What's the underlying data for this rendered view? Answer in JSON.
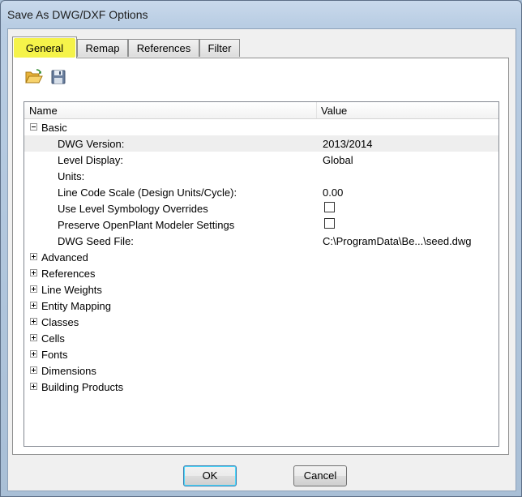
{
  "window": {
    "title": "Save As DWG/DXF Options"
  },
  "tabs": [
    {
      "label": "General",
      "active": true,
      "highlight": "#f5f34a"
    },
    {
      "label": "Remap"
    },
    {
      "label": "References"
    },
    {
      "label": "Filter"
    }
  ],
  "toolbar": {
    "open_icon": "folder-open-icon",
    "save_icon": "floppy-disk-icon"
  },
  "grid": {
    "headers": {
      "name": "Name",
      "value": "Value"
    },
    "basic_group": {
      "label": "Basic",
      "expanded": true,
      "properties": [
        {
          "label": "DWG Version:",
          "value": "2013/2014"
        },
        {
          "label": "Level Display:",
          "value": "Global"
        },
        {
          "label": "Units:",
          "value": ""
        },
        {
          "label": "Line Code Scale (Design Units/Cycle):",
          "value": "0.00"
        },
        {
          "label": "Use Level Symbology Overrides",
          "checked": false
        },
        {
          "label": "Preserve OpenPlant Modeler Settings",
          "checked": false
        },
        {
          "label": "DWG Seed File:",
          "value": "C:\\ProgramData\\Be...\\seed.dwg"
        }
      ]
    },
    "groups": [
      "Advanced",
      "References",
      "Line Weights",
      "Entity Mapping",
      "Classes",
      "Cells",
      "Fonts",
      "Dimensions",
      "Building Products"
    ]
  },
  "buttons": {
    "ok": "OK",
    "cancel": "Cancel"
  }
}
